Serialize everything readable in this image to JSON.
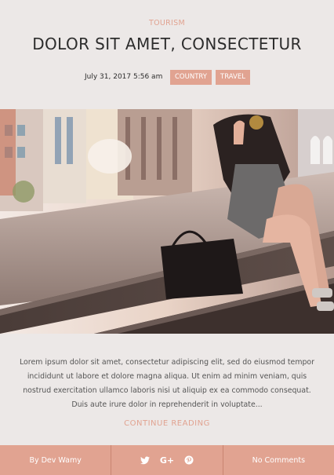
{
  "post": {
    "category": "TOURISM",
    "title": "DOLOR SIT AMET, CONSECTETUR",
    "date": "July 31, 2017 5:56 am",
    "tags": [
      "COUNTRY",
      "TRAVEL"
    ],
    "excerpt": "Lorem ipsum dolor sit amet, consectetur adipiscing elit, sed do eiusmod tempor incididunt ut labore et dolore magna aliqua. Ut enim ad minim veniam, quis nostrud exercitation ullamco laboris nisi ut aliquip ex ea commodo consequat. Duis aute irure dolor in reprehenderit in voluptate...",
    "continue_label": "CONTINUE READING"
  },
  "footer": {
    "author": "By Dev Wamy",
    "share_icons": [
      "twitter-icon",
      "google-plus-icon",
      "pinterest-icon"
    ],
    "google_plus_glyph": "G+",
    "comments": "No Comments"
  },
  "colors": {
    "accent": "#e1a391",
    "background": "#ece8e7",
    "title": "#2c2c2c"
  }
}
